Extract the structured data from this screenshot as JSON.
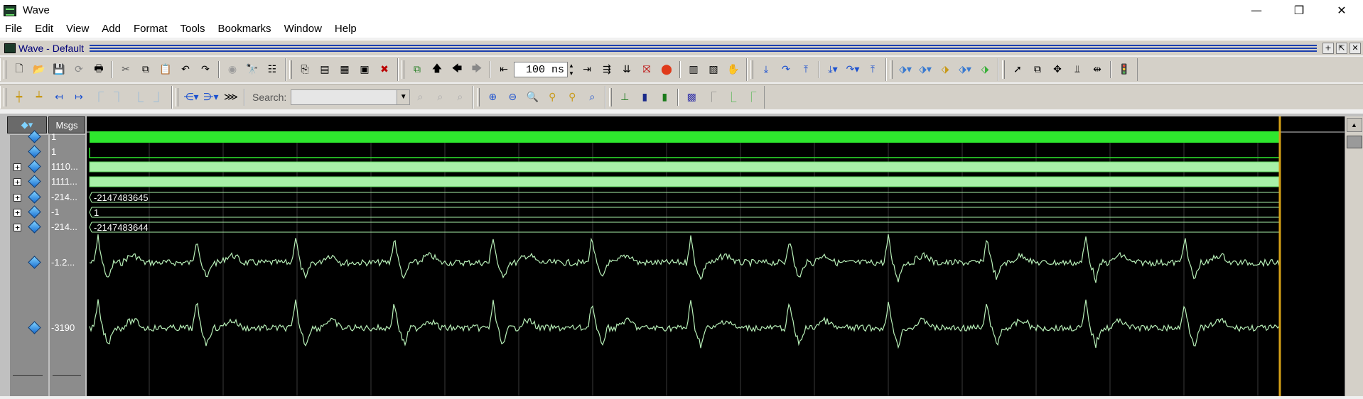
{
  "window": {
    "title": "Wave",
    "controls": [
      "—",
      "❐",
      "✕"
    ]
  },
  "menu": [
    "File",
    "Edit",
    "View",
    "Add",
    "Format",
    "Tools",
    "Bookmarks",
    "Window",
    "Help"
  ],
  "pane": {
    "title": "Wave - Default"
  },
  "toolbar": {
    "zoom_value": "100 ns",
    "search_label": "Search:",
    "search_value": ""
  },
  "wave": {
    "msgs_header": "Msgs",
    "signals": [
      {
        "value": "1",
        "type": "bit-high",
        "expandable": false
      },
      {
        "value": "1",
        "type": "bit-low",
        "expandable": false
      },
      {
        "value": "1110...",
        "type": "bus-green",
        "expandable": true
      },
      {
        "value": "1111...",
        "type": "bus-green",
        "expandable": true
      },
      {
        "value": "-214...",
        "type": "bus-value",
        "expandable": true,
        "bus_label": "-2147483645"
      },
      {
        "value": "-1",
        "type": "bus-value",
        "expandable": true,
        "bus_label": "1"
      },
      {
        "value": "-214...",
        "type": "bus-value",
        "expandable": true,
        "bus_label": "-2147483644"
      },
      {
        "value": "-1.2...",
        "type": "analog",
        "expandable": false
      },
      {
        "value": "-3190",
        "type": "analog",
        "expandable": false
      }
    ],
    "colors": {
      "bus": "#a8f0a8",
      "bit": "#2ee82e",
      "analog": "#b8f0b8",
      "cursor": "#d4a017",
      "grid": "#3a3a3a"
    }
  }
}
